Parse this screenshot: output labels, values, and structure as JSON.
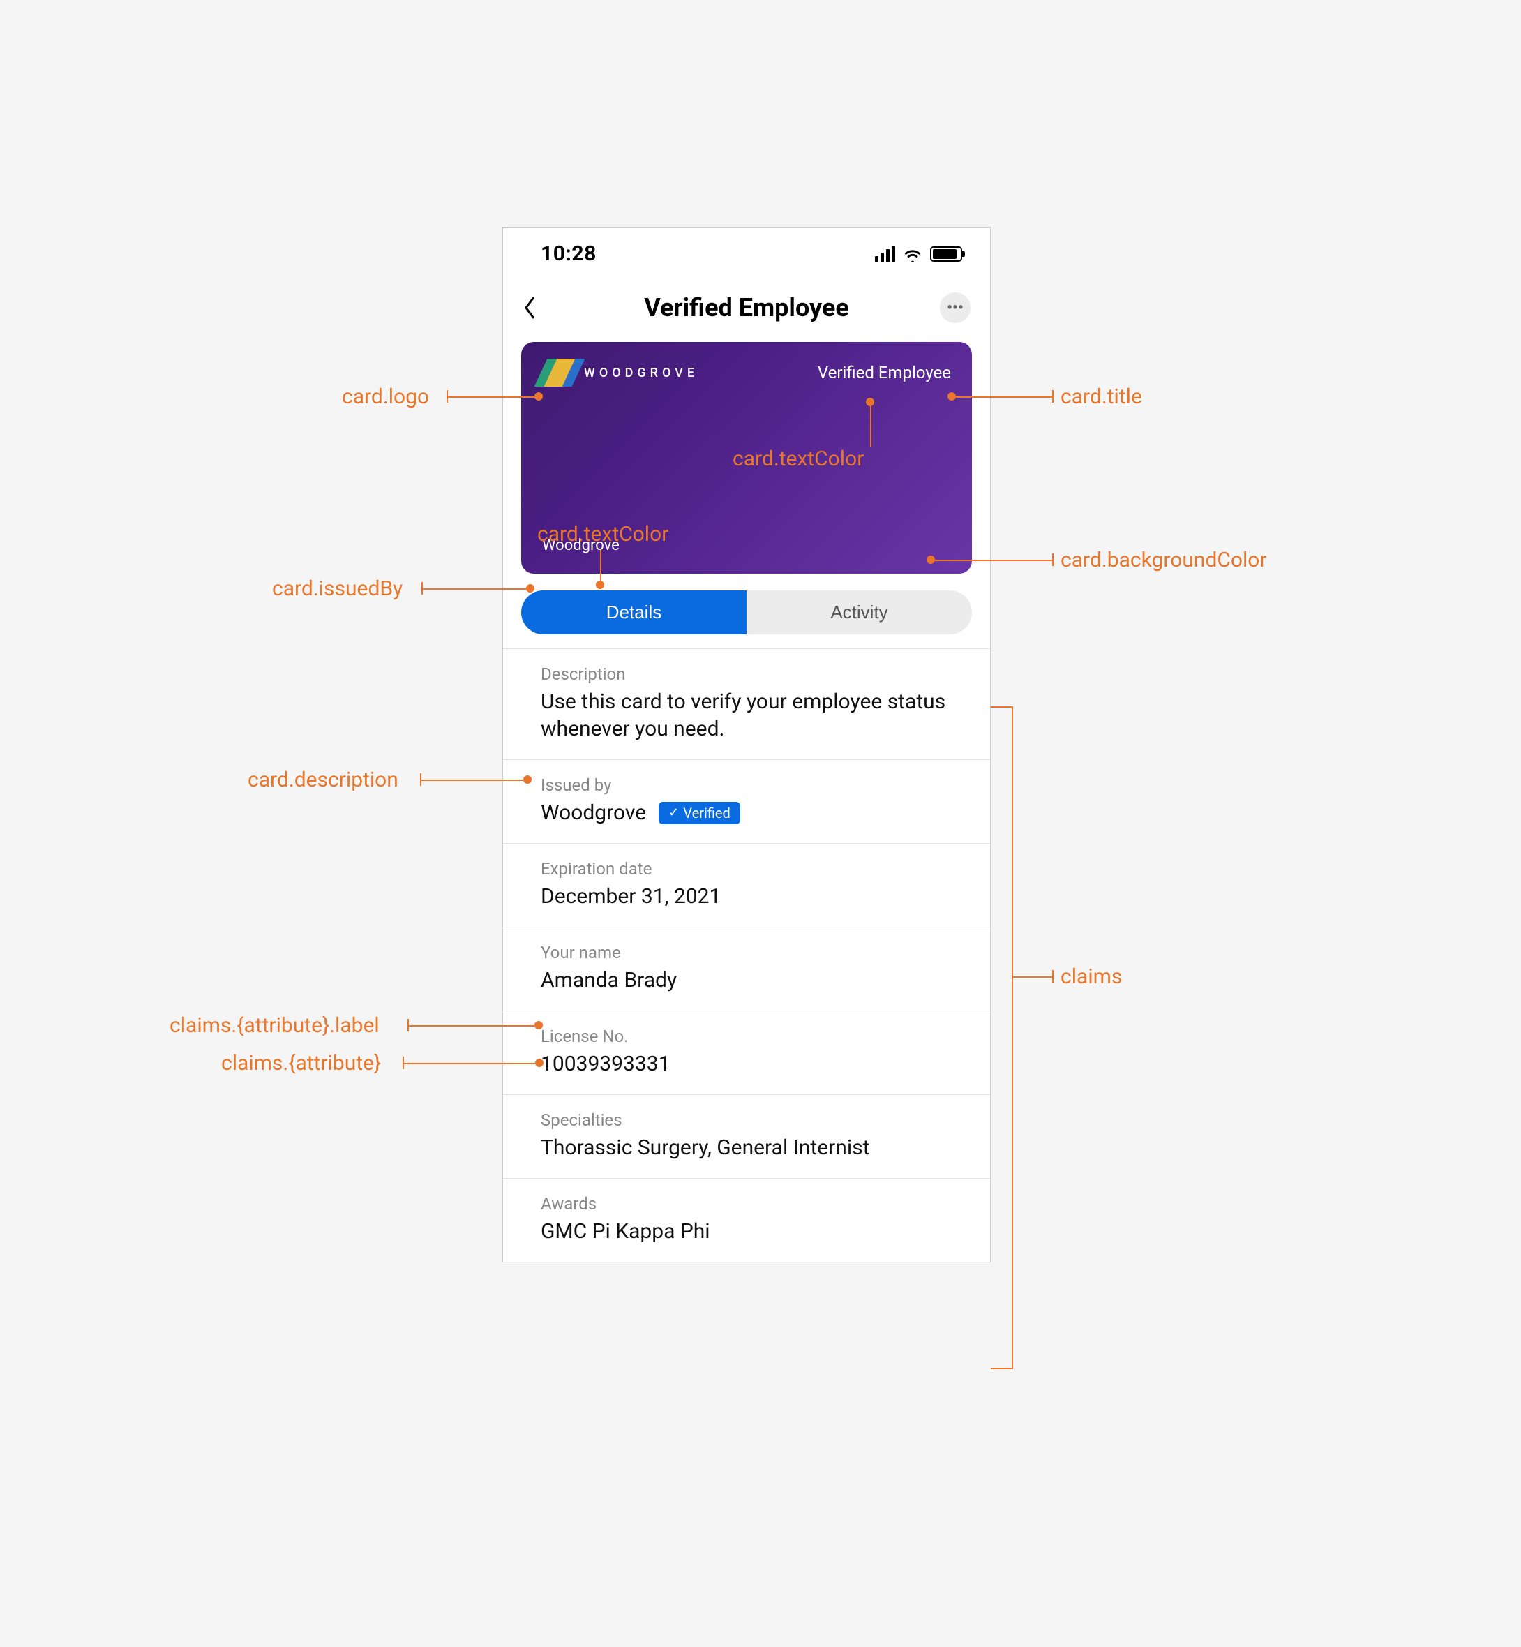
{
  "status": {
    "time": "10:28"
  },
  "nav": {
    "title": "Verified Employee"
  },
  "card": {
    "logo_text": "WOODGROVE",
    "title": "Verified Employee",
    "issuer": "Woodgrove"
  },
  "seg": {
    "details": "Details",
    "activity": "Activity"
  },
  "details": {
    "description_label": "Description",
    "description_value": "Use this card to verify your employee status whenever you need.",
    "issued_by_label": "Issued by",
    "issued_by_value": "Woodgrove",
    "verified_badge": "Verified",
    "exp_label": "Expiration date",
    "exp_value": "December 31, 2021",
    "name_label": "Your name",
    "name_value": "Amanda Brady",
    "license_label": "License No.",
    "license_value": "10039393331",
    "spec_label": "Specialties",
    "spec_value": "Thorassic Surgery, General Internist",
    "awards_label": "Awards",
    "awards_value": "GMC Pi Kappa Phi"
  },
  "annotations": {
    "logo": "card.logo",
    "title": "card.title",
    "text_color": "card.textColor",
    "issued_by": "card.issuedBy",
    "background": "card.backgroundColor",
    "description": "card.description",
    "claim_label": "claims.{attribute}.label",
    "claim_value": "claims.{attribute}",
    "claims": "claims"
  }
}
